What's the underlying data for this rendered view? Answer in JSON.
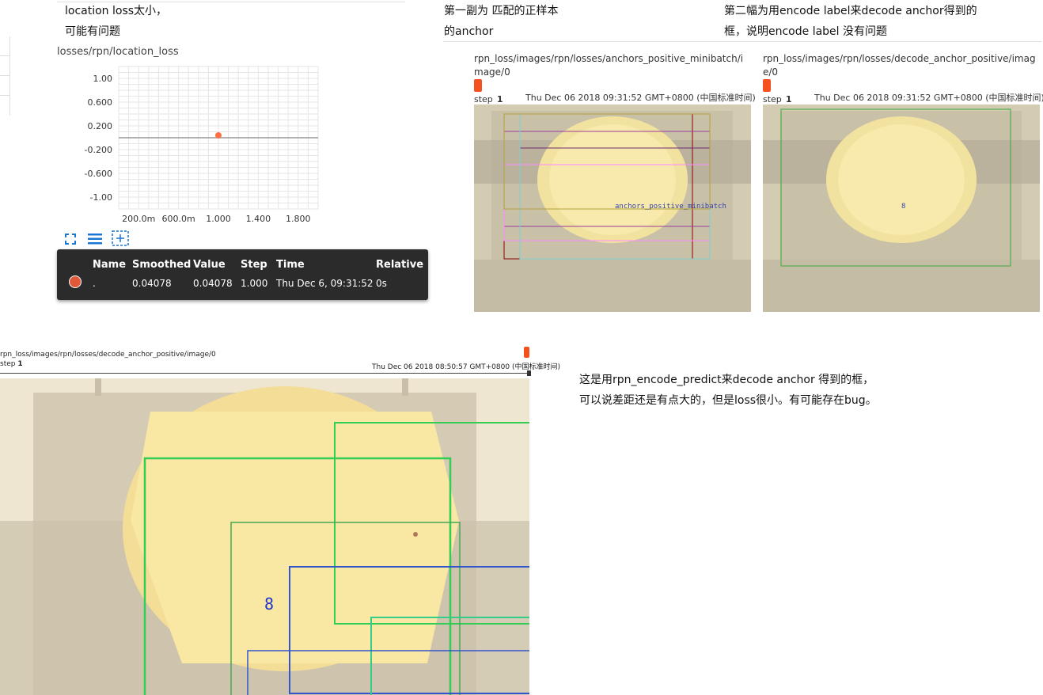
{
  "left_note": {
    "line1": "location loss太小，",
    "line2": "可能有问题"
  },
  "scalar_chart": {
    "title": "losses/rpn/location_loss",
    "y_ticks": [
      "1.00",
      "0.600",
      "0.200",
      "-0.200",
      "-0.600",
      "-1.00"
    ],
    "x_ticks": [
      "200.0m",
      "600.0m",
      "1.000",
      "1.400",
      "1.800"
    ],
    "icons": [
      "fit-domain-icon",
      "data-table-icon",
      "toggle-y-log-icon"
    ],
    "accent": "#ff7043"
  },
  "chart_data": {
    "type": "scatter",
    "title": "losses/rpn/location_loss",
    "xlabel": "",
    "ylabel": "",
    "xlim": [
      0.0,
      2.0
    ],
    "ylim": [
      -1.2,
      1.2
    ],
    "series": [
      {
        "x": [
          1.0
        ],
        "y": [
          0.04078
        ]
      }
    ]
  },
  "tooltip": {
    "headers": [
      "Name",
      "Smoothed",
      "Value",
      "Step",
      "Time",
      "Relative"
    ],
    "row": {
      "name": ".",
      "smoothed": "0.04078",
      "value": "0.04078",
      "step": "1.000",
      "time": "Thu Dec 6, 09:31:52",
      "relative": "0s"
    }
  },
  "note_first": {
    "line1": "第一副为 匹配的正样本",
    "line2": "的anchor"
  },
  "note_second": {
    "line1": "第二幅为用encode label来decode anchor得到的",
    "line2": "框，说明encode label 没有问题"
  },
  "image_card_1": {
    "title": "rpn_loss/images/rpn/losses/anchors_positive_minibatch/image/0",
    "step_label": "step",
    "step_value": "1",
    "date": "Thu Dec 06 2018 09:31:52 GMT+0800 (中国标准时间)",
    "overlay_text": "anchors_positive_minibatch"
  },
  "image_card_2": {
    "title": "rpn_loss/images/rpn/losses/decode_anchor_positive/image/0",
    "step_label": "step",
    "step_value": "1",
    "date": "Thu Dec 06 2018 09:31:52 GMT+0800 (中国标准时间)",
    "overlay_text": "8"
  },
  "image_card_3": {
    "title": "rpn_loss/images/rpn/losses/decode_anchor_positive/image/0",
    "step_label": "step",
    "step_value": "1",
    "date": "Thu Dec 06 2018 08:50:57 GMT+0800 (中国标准时间)",
    "overlay_text": "8"
  },
  "bottom_note": {
    "line1": "这是用rpn_encode_predict来decode anchor 得到的框，",
    "line2": "可以说差距还是有点大的，但是loss很小。有可能存在bug。"
  }
}
